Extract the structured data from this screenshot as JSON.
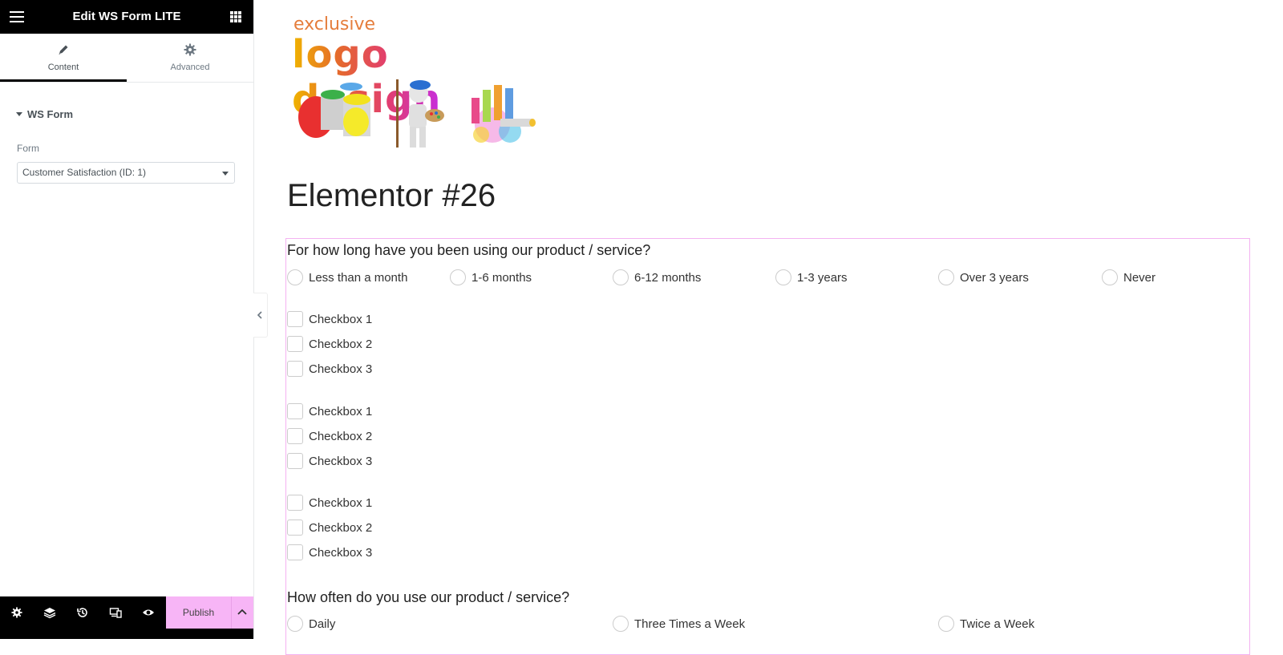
{
  "panel": {
    "title": "Edit WS Form LITE",
    "tabs": [
      {
        "label": "Content",
        "icon": "pencil-icon",
        "active": true
      },
      {
        "label": "Advanced",
        "icon": "gear-icon",
        "active": false
      }
    ],
    "section_title": "WS Form",
    "form_label": "Form",
    "form_value": "Customer Satisfaction (ID: 1)"
  },
  "footer": {
    "icons": [
      "settings-icon",
      "layers-icon",
      "history-icon",
      "responsive-icon",
      "preview-icon"
    ],
    "publish_label": "Publish",
    "accent": "#f7b5f6"
  },
  "preview": {
    "logo_text_top": "exclusive",
    "logo_text_main": "logo design",
    "page_title": "Elementor #26",
    "q1": {
      "label": "For how long have you been using our product / service?",
      "options": [
        "Less than a month",
        "1-6 months",
        "6-12 months",
        "1-3 years",
        "Over 3 years",
        "Never"
      ]
    },
    "checkbox_groups": [
      [
        "Checkbox 1",
        "Checkbox 2",
        "Checkbox 3"
      ],
      [
        "Checkbox 1",
        "Checkbox 2",
        "Checkbox 3"
      ],
      [
        "Checkbox 1",
        "Checkbox 2",
        "Checkbox 3"
      ]
    ],
    "q2": {
      "label": "How often do you use our product / service?",
      "options": [
        "Daily",
        "Three Times a Week",
        "Twice a Week"
      ]
    },
    "form_outline_color": "#f4b2f1"
  }
}
